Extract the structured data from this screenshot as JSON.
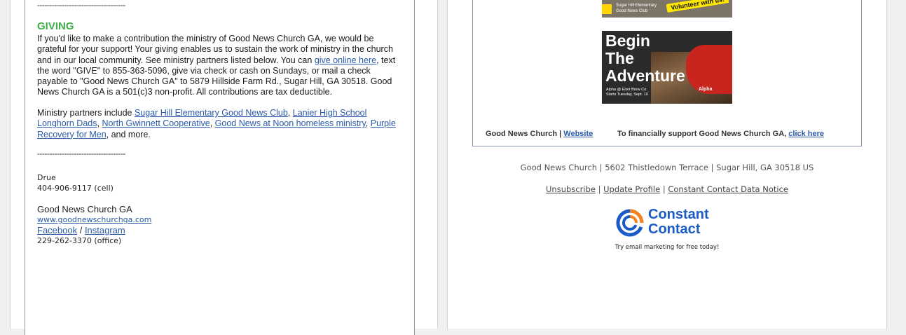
{
  "left": {
    "divider_top": "------------------------------------",
    "giving_heading": "GIVING",
    "giving_para_pre": "If you'd like to make a contribution the ministry of Good News Church GA, we would be grateful for your support! Your giving enables us to sustain the work of ministry in the church and in our local community. See ministry partners listed below. You can ",
    "give_online_link": "give online here",
    "giving_para_post": ", text the word \"GIVE\" to 855-363-5096, give via check or cash on Sundays, or mail a check payable to \"Good News Church GA\" to 5879 Hillside Farm Rd., Sugar Hill, GA 30518. Good News Church GA is a 501(c)3 non-profit. All contributions are tax deductible.",
    "partners_intro": "Ministry partners include ",
    "partner_links": [
      "Sugar Hill Elementary Good News Club",
      "Lanier High School Longhorn Dads",
      "North Gwinnett Cooperative",
      "Good News at Noon homeless ministry",
      "Purple Recovery for Men"
    ],
    "sep_comma": ", ",
    "partners_outro": ", and more.",
    "divider_bottom": "------------------------------------",
    "signature": {
      "name": "Drue",
      "cell": "404-906-9117 (cell)",
      "org": "Good News Church GA",
      "website": "www.goodnewschurchga.com",
      "facebook": "Facebook",
      "slash": " / ",
      "instagram": "Instagram",
      "office": "229-262-3370 (office)"
    }
  },
  "right": {
    "volunteer_banner": {
      "line1": "Sugar Hill Elementary",
      "line2": "Good News Club",
      "callout": "Volunteer with us!"
    },
    "adventure_image": {
      "headline_1": "Begin",
      "headline_2": "The",
      "headline_3": "Adventure",
      "small_1": "Alpha @ Elixir Brew Co.",
      "small_2": "Starts Tuesday, Sept. 10",
      "badge": "Alpha"
    },
    "footer_left_text": "Good News Church | ",
    "footer_left_link": "Website",
    "footer_right_text": "To financially support Good News Church GA, ",
    "footer_right_link": "click here",
    "address": "Good News Church | 5602 Thistledown Terrace | Sugar Hill, GA 30518 US",
    "links": {
      "unsubscribe": "Unsubscribe",
      "update_profile": "Update Profile",
      "data_notice": "Constant Contact Data Notice",
      "sep": " | "
    },
    "cc_logo_line1": "Constant",
    "cc_logo_line2": "Contact",
    "cc_tagline": "Try email marketing for free today!",
    "brand_color": "#1a5bc5",
    "accent_color": "#f58220"
  }
}
